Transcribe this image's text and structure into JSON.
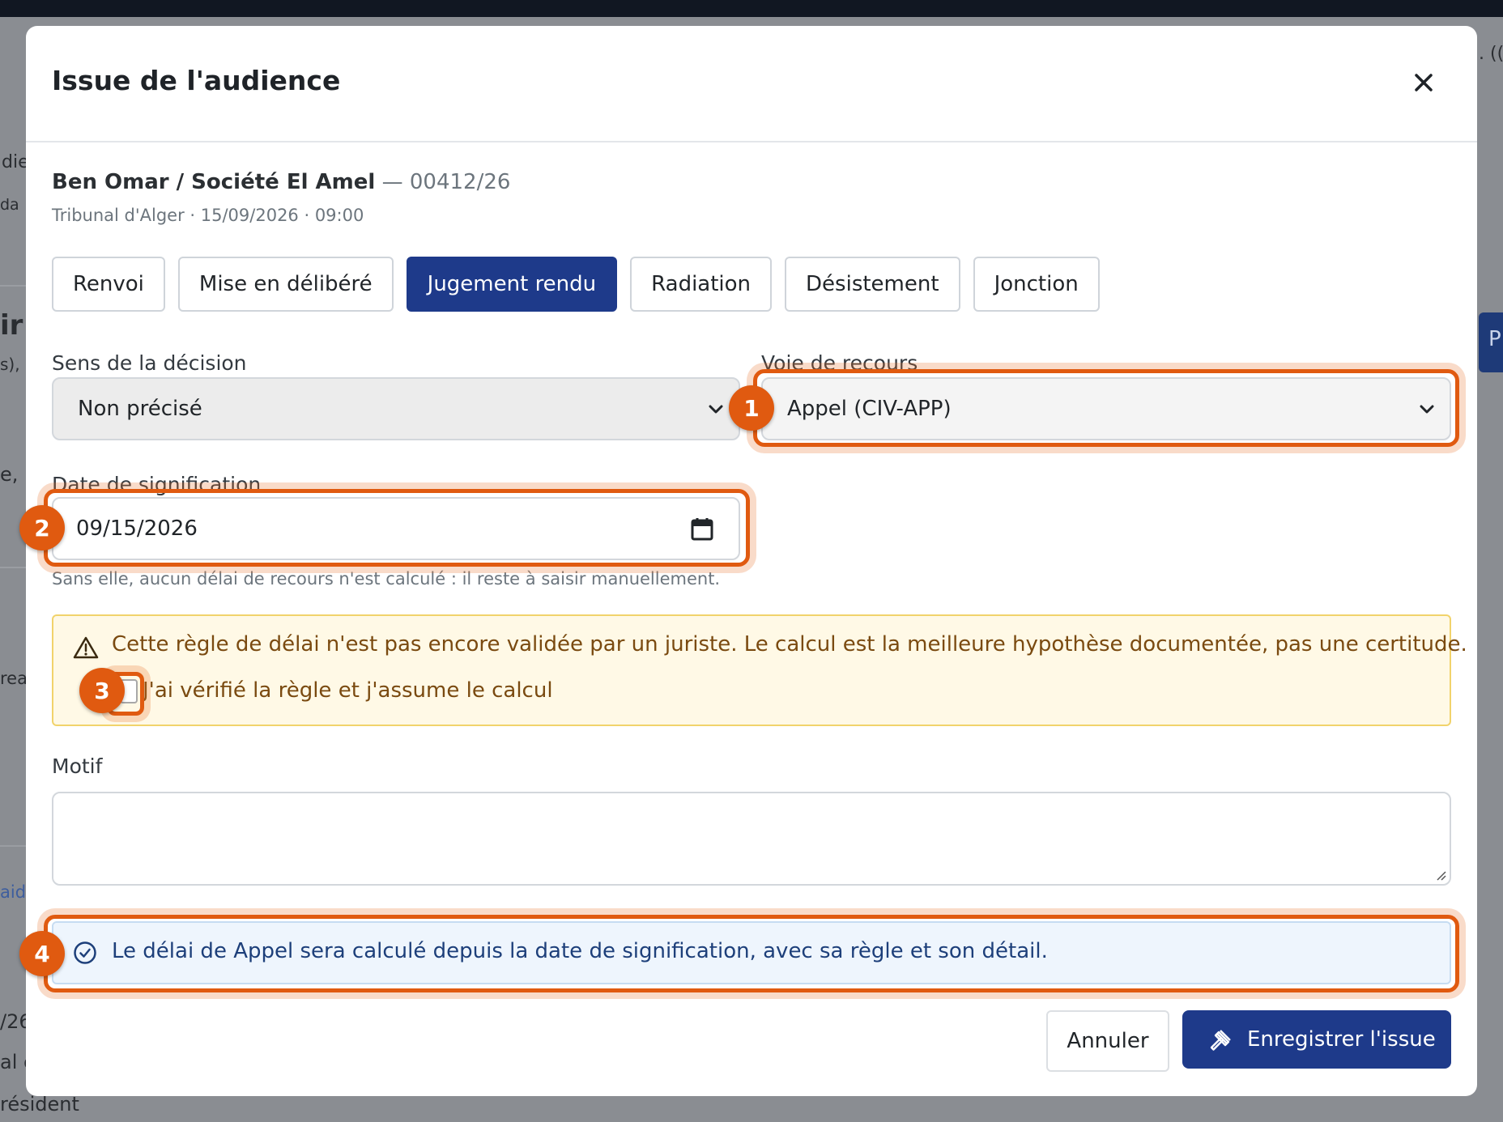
{
  "background": {
    "fragments": [
      "die",
      "da",
      "ir",
      "s),",
      "e, p",
      "rea",
      "aido",
      "/26",
      "al c",
      "résident",
      ". (("
    ],
    "side_tab_label": "P"
  },
  "modal": {
    "title": "Issue de l'audience",
    "case": {
      "parties": "Ben Omar / Société El Amel",
      "separator": " — ",
      "number": "00412/26",
      "details": "Tribunal d'Alger · 15/09/2026 · 09:00"
    },
    "outcomes": [
      {
        "label": "Renvoi",
        "active": false
      },
      {
        "label": "Mise en délibéré",
        "active": false
      },
      {
        "label": "Jugement rendu",
        "active": true
      },
      {
        "label": "Radiation",
        "active": false
      },
      {
        "label": "Désistement",
        "active": false
      },
      {
        "label": "Jonction",
        "active": false
      }
    ],
    "decision": {
      "label": "Sens de la décision",
      "value": "Non précisé"
    },
    "recours": {
      "label": "Voie de recours",
      "value": "Appel (CIV-APP)"
    },
    "signification": {
      "label": "Date de signification",
      "value": "09/15/2026",
      "help": "Sans elle, aucun délai de recours n'est calculé : il reste à saisir manuellement."
    },
    "warning": {
      "text": "Cette règle de délai n'est pas encore validée par un juriste. Le calcul est la meilleure hypothèse documentée, pas une certitude.",
      "checkbox_label": "J'ai vérifié la règle et j'assume le calcul",
      "checked": false
    },
    "motif": {
      "label": "Motif",
      "value": ""
    },
    "info": {
      "text": "Le délai de Appel sera calculé depuis la date de signification, avec sa règle et son détail."
    },
    "cancel_label": "Annuler",
    "save_label": "Enregistrer l'issue"
  },
  "annotations": [
    "1",
    "2",
    "3",
    "4"
  ],
  "colors": {
    "primary": "#1e3a8a",
    "highlight": "#e05a10",
    "warning_bg": "#fff9e6",
    "info_bg": "#eef5fd"
  }
}
